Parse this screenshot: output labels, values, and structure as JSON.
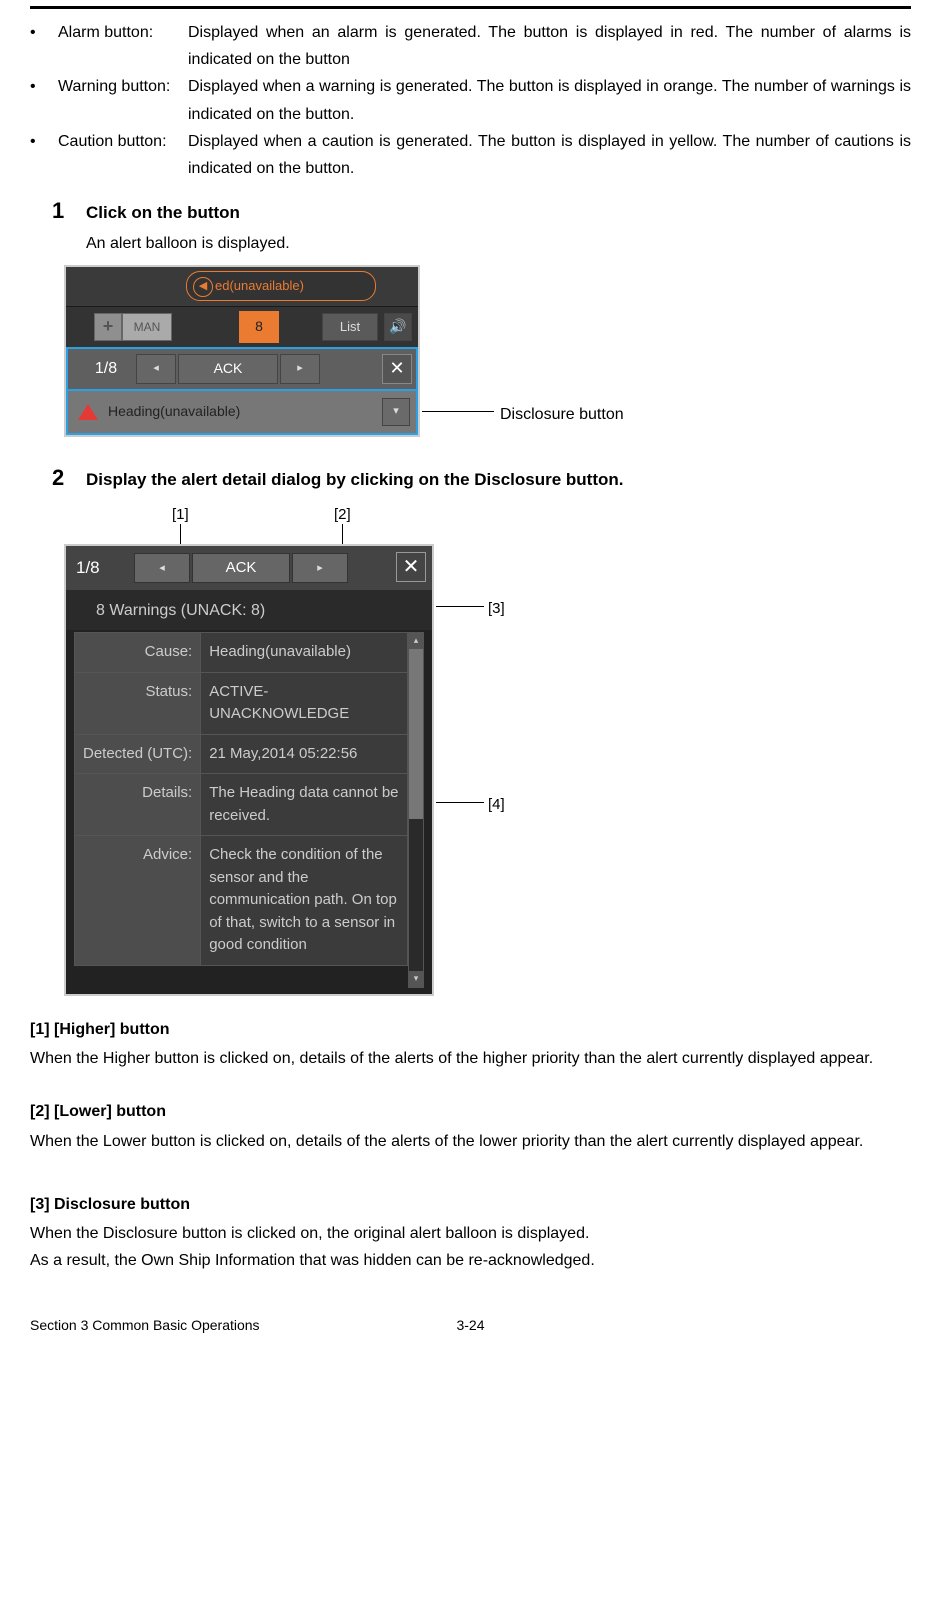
{
  "defs": {
    "bullet": "•",
    "alarm": {
      "term": "Alarm button:",
      "desc": "Displayed when an alarm is generated. The button is displayed in red. The number of alarms is indicated on the button"
    },
    "warning": {
      "term": "Warning button:",
      "desc": "Displayed when a warning is generated. The button is displayed in orange. The number of warnings is indicated on the button."
    },
    "caution": {
      "term": "Caution button:",
      "desc": "Displayed when a caution is generated. The button is displayed in yellow. The number of cautions is indicated on the button."
    }
  },
  "step1": {
    "num": "1",
    "title": "Click on the button",
    "body": "An alert balloon is displayed."
  },
  "fig1": {
    "pill_arrow": "◀",
    "pill_text": "ed(unavailable)",
    "plus": "+",
    "man": "MAN",
    "orange": "8",
    "list": "List",
    "speaker": "🔊",
    "count": "1/8",
    "prev": "◂",
    "ack": "ACK",
    "next": "▸",
    "close": "✕",
    "alert_text": "Heading(unavailable)",
    "disc": "▾",
    "callout": "Disclosure button"
  },
  "step2": {
    "num": "2",
    "title": "Display the alert detail dialog by clicking on the Disclosure button."
  },
  "fig2": {
    "labels": {
      "l1": "[1]",
      "l2": "[2]",
      "l3": "[3]",
      "l4": "[4]"
    },
    "count": "1/8",
    "prev": "◂",
    "ack": "ACK",
    "next": "▸",
    "close": "✕",
    "summary": "8 Warnings (UNACK: 8)",
    "rows": {
      "cause_k": "Cause:",
      "cause_v": "Heading(unavailable)",
      "status_k": "Status:",
      "status_v": "ACTIVE-UNACKNOWLEDGE",
      "det_k": "Detected (UTC):",
      "det_v": "21 May,2014 05:22:56",
      "details_k": "Details:",
      "details_v": "The Heading data cannot be received.",
      "advice_k": "Advice:",
      "advice_v": "Check the condition of the sensor and the communication path. On top of that, switch to a sensor in good condition"
    },
    "scroll_up": "▴",
    "scroll_dn": "▾"
  },
  "sections": {
    "s1h": "[1] [Higher] button",
    "s1b": "When the Higher button is clicked on, details of the alerts of the higher priority than the alert currently displayed appear.",
    "s2h": "[2] [Lower] button",
    "s2b": "When the Lower button is clicked on, details of the alerts of the lower priority than the alert currently displayed appear.",
    "s3h": "[3] Disclosure button",
    "s3b1": "When the Disclosure button is clicked on, the original alert balloon is displayed.",
    "s3b2": "As a result, the Own Ship Information that was hidden can be re-acknowledged."
  },
  "footer": {
    "left": "Section 3    Common Basic Operations",
    "mid": "3-24"
  }
}
